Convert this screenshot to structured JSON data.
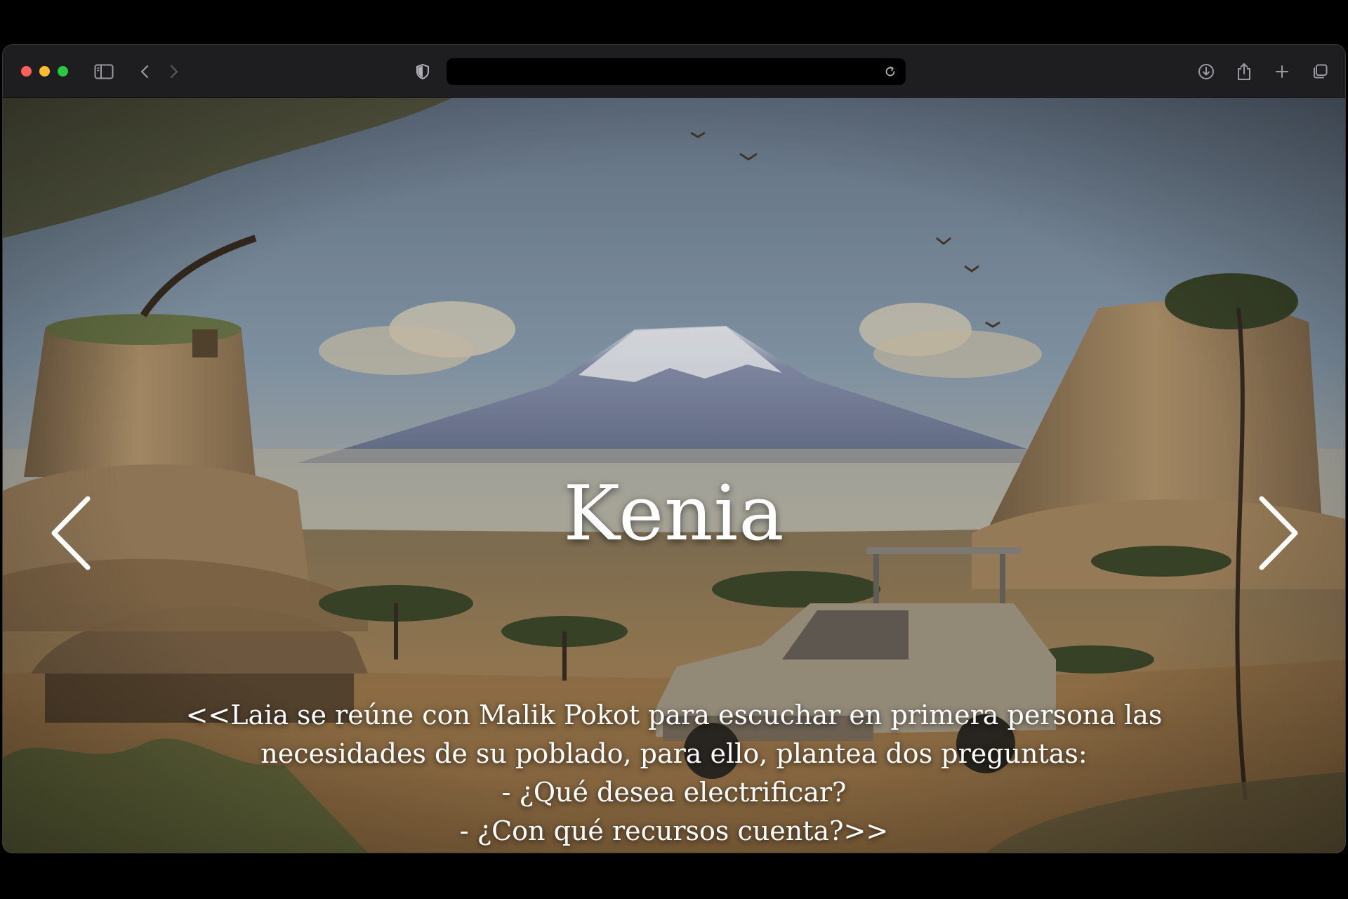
{
  "browser": {
    "address_value": "",
    "address_placeholder": ""
  },
  "slide": {
    "title": "Kenia",
    "caption_lines": [
      "<<Laia se reúne con Malik Pokot para escuchar en primera persona las",
      "necesidades de su poblado, para ello, plantea dos preguntas:",
      "- ¿Qué desea electrificar?",
      "- ¿Con qué recursos cuenta?>>"
    ]
  },
  "icons": {
    "sidebar": "sidebar-icon",
    "back": "chevron-left-icon",
    "forward": "chevron-right-icon",
    "privacy": "shield-icon",
    "reload": "reload-icon",
    "downloads": "download-icon",
    "share": "share-icon",
    "new_tab": "plus-icon",
    "tabs": "tabs-overview-icon",
    "prev": "arrow-left-icon",
    "next": "arrow-right-icon"
  },
  "colors": {
    "close": "#ff5f57",
    "minimize": "#febc2e",
    "zoom": "#28c840",
    "toolbar": "#1e1e20",
    "title_text": "#ffffff"
  }
}
